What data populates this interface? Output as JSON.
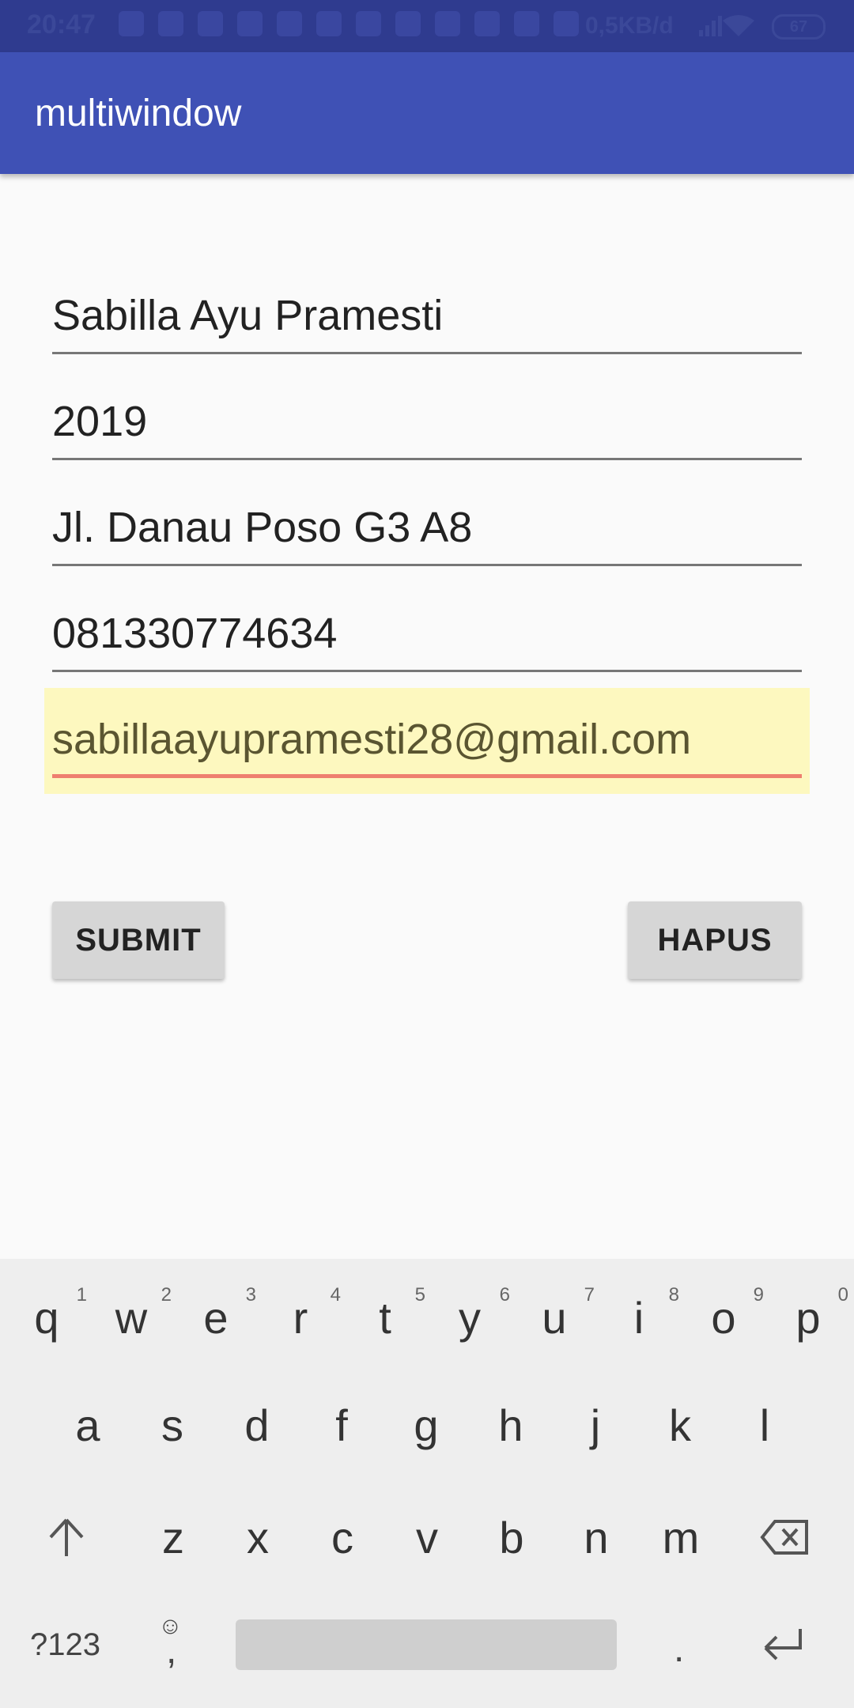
{
  "status_bar": {
    "time": "20:47",
    "speed": "0,5KB/d",
    "battery": "67"
  },
  "app_bar": {
    "title": "multiwindow"
  },
  "form": {
    "name": "Sabilla Ayu Pramesti",
    "year": "2019",
    "address": "Jl. Danau Poso G3 A8",
    "phone": "081330774634",
    "email": "sabillaayupramesti28@gmail.com"
  },
  "buttons": {
    "submit": "SUBMIT",
    "hapus": "HAPUS"
  },
  "keyboard": {
    "row1": [
      {
        "k": "q",
        "n": "1"
      },
      {
        "k": "w",
        "n": "2"
      },
      {
        "k": "e",
        "n": "3"
      },
      {
        "k": "r",
        "n": "4"
      },
      {
        "k": "t",
        "n": "5"
      },
      {
        "k": "y",
        "n": "6"
      },
      {
        "k": "u",
        "n": "7"
      },
      {
        "k": "i",
        "n": "8"
      },
      {
        "k": "o",
        "n": "9"
      },
      {
        "k": "p",
        "n": "0"
      }
    ],
    "row2": [
      "a",
      "s",
      "d",
      "f",
      "g",
      "h",
      "j",
      "k",
      "l"
    ],
    "row3": [
      "z",
      "x",
      "c",
      "v",
      "b",
      "n",
      "m"
    ],
    "symbols_label": "?123",
    "comma": ",",
    "period": "."
  }
}
